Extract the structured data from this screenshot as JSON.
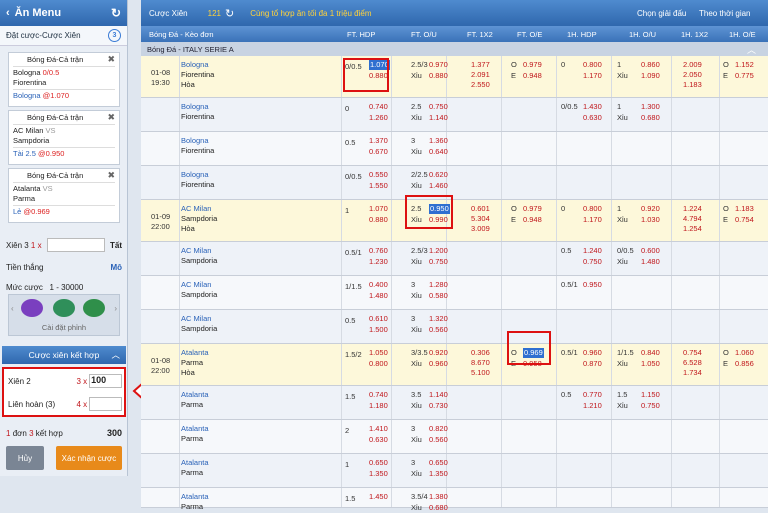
{
  "sidebar": {
    "title": "Ăn Menu",
    "subtitle": "Đặt cược-Cược Xiên",
    "badge": "3",
    "bets": [
      {
        "league": "Bóng Đá-Cả trận",
        "home": "Bologna",
        "handicap": "0/0.5",
        "away": "Fiorentina",
        "pick": "Bologna",
        "odds": "1.070"
      },
      {
        "league": "Bóng Đá-Cả trận",
        "home": "AC Milan",
        "handicap": "VS",
        "away": "Sampdoria",
        "pick": "Tài 2.5",
        "odds": "0.950"
      },
      {
        "league": "Bóng Đá-Cả trận",
        "home": "Atalanta",
        "handicap": "VS",
        "away": "Parma",
        "pick": "Lẻ",
        "odds": "0.969"
      }
    ],
    "xien_label": "Xiên 3",
    "xien_mult": "1 x",
    "xien_action": "Tất",
    "tien_thang": "Tiền thắng",
    "tien_action": "Mô",
    "muc_cuoc": "Mức cược",
    "muc_range": "1 - 30000",
    "cai_dat": "Cài đặt phỉnh",
    "combo_title": "Cược xiên kết hợp",
    "combos": [
      {
        "label": "Xiên 2",
        "mult": "3 x",
        "value": "100"
      },
      {
        "label": "Liên hoàn (3)",
        "mult": "4 x",
        "value": ""
      }
    ],
    "summary_a": "1",
    "summary_b": "đơn",
    "summary_c": "3",
    "summary_d": "kết hợp",
    "summary_total": "300",
    "cancel": "Hủy",
    "confirm": "Xác nhận cược"
  },
  "topbar": {
    "title": "Cược Xiên",
    "count": "121",
    "promo": "Cùng tổ hợp ăn tối đa 1 triệu điểm",
    "sort": "Chọn giải đấu",
    "time": "Theo thời gian"
  },
  "headers": {
    "match": "Bóng Đá - Kèo đơn",
    "ft_hdp": "FT. HDP",
    "ft_ou": "FT. O/U",
    "ft_1x2": "FT. 1X2",
    "ft_oe": "FT. O/E",
    "h1_hdp": "1H. HDP",
    "h1_ou": "1H. O/U",
    "h1_1x2": "1H. 1X2",
    "h1_oe": "1H. O/E"
  },
  "league": "Bóng Đá - ITALY SERIE A",
  "rows": [
    {
      "date": "01-08",
      "time": "19:30",
      "home": "Bologna",
      "away": "Fiorentina",
      "draw": "Hòa",
      "hdp_l": "0/0.5",
      "hdp1": "1.070",
      "hdp2": "0.880",
      "ou_l": "2.5/3",
      "ou_x": "Xỉu",
      "ou1": "0.970",
      "ou2": "0.880",
      "x1": "1.377",
      "x2": "2.091",
      "x3": "2.550",
      "oe1": "0.979",
      "oe2": "0.948",
      "hh_l": "0",
      "hh1": "0.800",
      "hh2": "1.170",
      "ho_l": "1",
      "ho_x": "Xỉu",
      "ho1": "0.860",
      "ho2": "1.090",
      "hx1": "2.009",
      "hx2": "2.050",
      "hx3": "1.183",
      "hoe1": "1.152",
      "hoe2": "0.775"
    },
    {
      "home": "Bologna",
      "away": "Fiorentina",
      "hdp_l": "0",
      "hdp1": "0.740",
      "hdp2": "1.260",
      "ou_l": "2.5",
      "ou_x": "Xỉu",
      "ou1": "0.750",
      "ou2": "1.140",
      "hh_l": "0/0.5",
      "hh1": "1.430",
      "hh2": "0.630",
      "ho_l": "1",
      "ho_x": "Xỉu",
      "ho1": "1.300",
      "ho2": "0.680"
    },
    {
      "home": "Bologna",
      "away": "Fiorentina",
      "hdp_l": "0.5",
      "hdp1": "1.370",
      "hdp2": "0.670",
      "ou_l": "3",
      "ou_x": "Xỉu",
      "ou1": "1.360",
      "ou2": "0.640"
    },
    {
      "home": "Bologna",
      "away": "Fiorentina",
      "hdp_l": "0/0.5",
      "hdp1": "0.550",
      "hdp2": "1.550",
      "ou_l": "2/2.5",
      "ou_x": "Xỉu",
      "ou1": "0.620",
      "ou2": "1.460"
    },
    {
      "date": "01-09",
      "time": "22:00",
      "home": "AC Milan",
      "away": "Sampdoria",
      "draw": "Hòa",
      "hdp_l": "1",
      "hdp1": "1.070",
      "hdp2": "0.880",
      "ou_l": "2.5",
      "ou_x": "Xỉu",
      "ou1": "0.950",
      "ou2": "0.990",
      "x1": "0.601",
      "x2": "5.304",
      "x3": "3.009",
      "oe1": "0.979",
      "oe2": "0.948",
      "hh_l": "0",
      "hh1": "0.800",
      "hh2": "1.170",
      "ho_l": "1",
      "ho_x": "Xỉu",
      "ho1": "0.920",
      "ho2": "1.030",
      "hx1": "1.224",
      "hx2": "4.794",
      "hx3": "1.254",
      "hoe1": "1.183",
      "hoe2": "0.754"
    },
    {
      "home": "AC Milan",
      "away": "Sampdoria",
      "hdp_l": "0.5/1",
      "hdp1": "0.760",
      "hdp2": "1.230",
      "ou_l": "2.5/3",
      "ou_x": "Xỉu",
      "ou1": "1.200",
      "ou2": "0.750",
      "hh_l": "0.5",
      "hh1": "1.240",
      "hh2": "0.750",
      "ho_l": "0/0.5",
      "ho_x": "Xỉu",
      "ho1": "0.600",
      "ho2": "1.480"
    },
    {
      "home": "AC Milan",
      "away": "Sampdoria",
      "hdp_l": "1/1.5",
      "hdp1": "0.400",
      "hdp2": "1.480",
      "ou_l": "3",
      "ou_x": "Xỉu",
      "ou1": "1.280",
      "ou2": "0.580",
      "hh_l": "0.5/1",
      "hh1": "0.950"
    },
    {
      "home": "AC Milan",
      "away": "Sampdoria",
      "hdp_l": "0.5",
      "hdp1": "0.610",
      "hdp2": "1.500",
      "ou_l": "3",
      "ou_x": "Xỉu",
      "ou1": "1.320",
      "ou2": "0.560"
    },
    {
      "date": "01-08",
      "time": "22:00",
      "home": "Atalanta",
      "away": "Parma",
      "draw": "Hòa",
      "hdp_l": "1.5/2",
      "hdp1": "1.050",
      "hdp2": "0.800",
      "ou_l": "3/3.5",
      "ou_x": "Xỉu",
      "ou1": "0.920",
      "ou2": "0.960",
      "x1": "0.306",
      "x2": "8.670",
      "x3": "5.100",
      "oe1": "0.969",
      "oe2": "0.958",
      "hh_l": "0.5/1",
      "hh1": "0.960",
      "hh2": "0.870",
      "ho_l": "1/1.5",
      "ho_x": "Xỉu",
      "ho1": "0.840",
      "ho2": "1.050",
      "hx1": "0.754",
      "hx2": "6.528",
      "hx3": "1.734",
      "hoe1": "1.060",
      "hoe2": "0.856"
    },
    {
      "home": "Atalanta",
      "away": "Parma",
      "hdp_l": "1.5",
      "hdp1": "0.740",
      "hdp2": "1.180",
      "ou_l": "3.5",
      "ou_x": "Xỉu",
      "ou1": "1.140",
      "ou2": "0.730",
      "hh_l": "0.5",
      "hh1": "0.770",
      "hh2": "1.210",
      "ho_l": "1.5",
      "ho_x": "Xỉu",
      "ho1": "1.150",
      "ho2": "0.750"
    },
    {
      "home": "Atalanta",
      "away": "Parma",
      "hdp_l": "2",
      "hdp1": "1.410",
      "hdp2": "0.630",
      "ou_l": "3",
      "ou_x": "Xỉu",
      "ou1": "0.820",
      "ou2": "0.560"
    },
    {
      "home": "Atalanta",
      "away": "Parma",
      "hdp_l": "1",
      "hdp1": "0.650",
      "hdp2": "1.350",
      "ou_l": "3",
      "ou_x": "Xỉu",
      "ou1": "0.650",
      "ou2": "1.350"
    },
    {
      "home": "Atalanta",
      "away": "Parma",
      "hdp_l": "1.5",
      "hdp1": "1.450",
      "ou_l": "3.5/4",
      "ou_x": "Xỉu",
      "ou1": "1.380",
      "ou2": "0.680"
    }
  ]
}
